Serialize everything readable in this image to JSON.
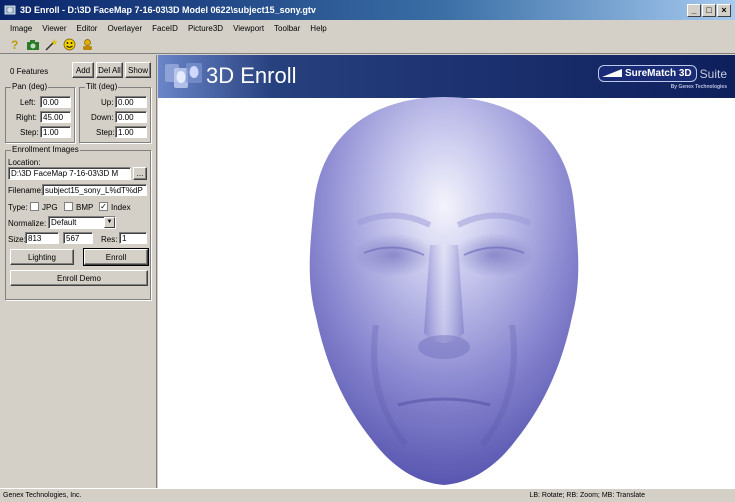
{
  "window": {
    "title": "3D Enroll - D:\\3D FaceMap 7-16-03\\3D Model 0622\\subject15_sony.gtv",
    "min": "_",
    "max": "□",
    "close": "×"
  },
  "menu": [
    "Image",
    "Viewer",
    "Editor",
    "Overlayer",
    "FaceID",
    "Picture3D",
    "Viewport",
    "Toolbar",
    "Help"
  ],
  "toolbar": [
    "help-icon",
    "camera-icon",
    "magic-icon",
    "face-icon",
    "user-icon"
  ],
  "features": {
    "count_label": "0 Features",
    "add": "Add",
    "del_all": "Del All",
    "show": "Show"
  },
  "pan": {
    "title": "Pan (deg)",
    "left_label": "Left:",
    "left_value": "0.00",
    "right_label": "Right:",
    "right_value": "45.00",
    "step_label": "Step:",
    "step_value": "1.00"
  },
  "tilt": {
    "title": "Tilt (deg)",
    "up_label": "Up:",
    "up_value": "0.00",
    "down_label": "Down:",
    "down_value": "0.00",
    "step_label": "Step:",
    "step_value": "1.00"
  },
  "enroll": {
    "title": "Enrollment Images",
    "location_label": "Location:",
    "location_value": "D:\\3D FaceMap 7-16-03\\3D M",
    "browse": "...",
    "filename_label": "Filename:",
    "filename_value": "subject15_sony_L%dT%dP",
    "type_label": "Type:",
    "jpg": "JPG",
    "bmp": "BMP",
    "index": "Index",
    "jpg_checked": false,
    "bmp_checked": false,
    "index_checked": true,
    "check_mark": "✓",
    "normalize_label": "Normalize:",
    "normalize_value": "Default",
    "size_label": "Size:",
    "size_w": "813",
    "size_h": "567",
    "res_label": "Res:",
    "res_value": "1"
  },
  "buttons": {
    "lighting": "Lighting",
    "enroll": "Enroll",
    "enroll_demo": "Enroll Demo"
  },
  "banner": {
    "title": "3D Enroll",
    "brand": "SureMatch 3D",
    "suite": "Suite",
    "byline": "By Genex Technologies"
  },
  "status": {
    "company": "Genex Technologies, Inc.",
    "hint": "LB: Rotate; RB: Zoom; MB: Translate"
  },
  "colors": {
    "face_light": "#e4e4f8",
    "face_dark": "#4c4aa8",
    "banner": "#0e1f5c"
  }
}
